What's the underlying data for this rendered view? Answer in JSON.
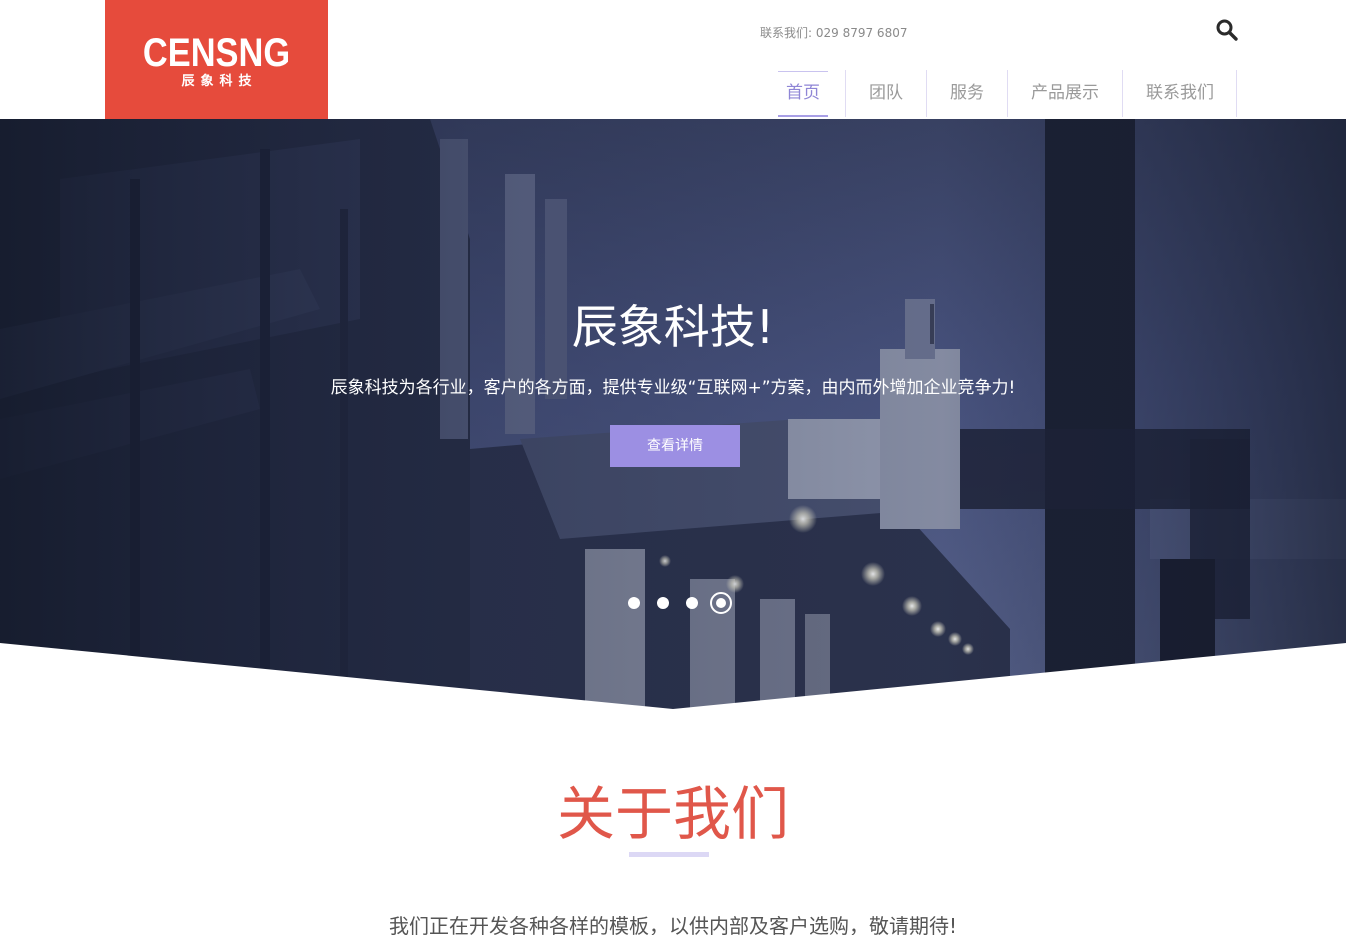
{
  "header": {
    "logo": {
      "main": "CENSNG",
      "sub": "辰象科技"
    },
    "contact": "联系我们: 029 8797 6807",
    "search_icon": "search-icon",
    "nav": [
      {
        "label": "首页",
        "active": true
      },
      {
        "label": "团队",
        "active": false
      },
      {
        "label": "服务",
        "active": false
      },
      {
        "label": "产品展示",
        "active": false
      },
      {
        "label": "联系我们",
        "active": false
      }
    ]
  },
  "hero": {
    "title": "辰象科技!",
    "subtitle": "辰象科技为各行业，客户的各方面，提供专业级“互联网+”方案，由内而外增加企业竞争力!",
    "button": "查看详情",
    "slides": {
      "count": 4,
      "active_index": 4
    }
  },
  "about": {
    "title": "关于我们",
    "text": "我们正在开发各种各样的模板，以供内部及客户选购，敬请期待!"
  },
  "colors": {
    "brand": "#e64b3c",
    "accent": "#9c8fe3",
    "nav_active": "#8f86d6",
    "about_title": "#e0574a"
  }
}
